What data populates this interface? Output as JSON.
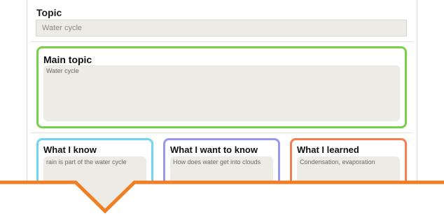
{
  "topic": {
    "label": "Topic",
    "value": "Water cycle"
  },
  "main_topic": {
    "title": "Main topic",
    "value": "Water cycle",
    "border_color": "#77d14a"
  },
  "columns": [
    {
      "title": "What I know",
      "value": "rain is part of the water cycle",
      "border_color": "#6fd3f2"
    },
    {
      "title": "What I want to know",
      "value": "How does water get into clouds",
      "border_color": "#9b96ee"
    },
    {
      "title": "What I learned",
      "value": "Condensation, evaporation",
      "border_color": "#f47f4e"
    }
  ],
  "overlay": {
    "pointer_color": "#f07e23",
    "pointer_fill": "#ecebe6"
  }
}
